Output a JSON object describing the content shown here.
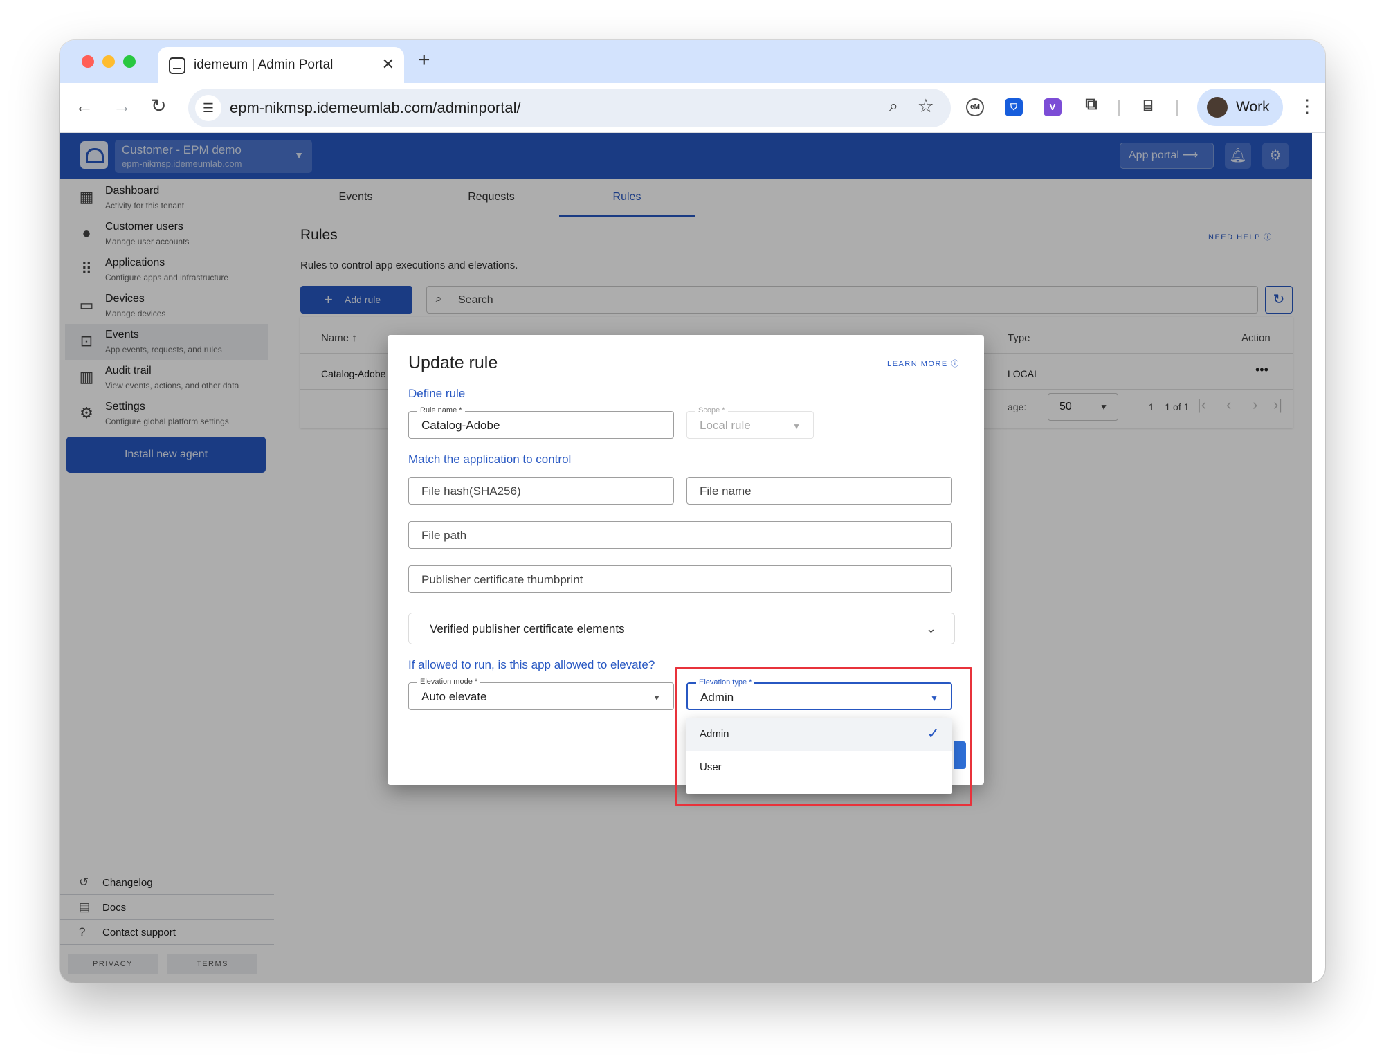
{
  "browser": {
    "tab_title": "idemeum | Admin Portal",
    "url": "epm-nikmsp.idemeumlab.com/adminportal/",
    "profile_label": "Work",
    "extensions": [
      "eM",
      "bitwarden",
      "V"
    ]
  },
  "header": {
    "tenant_name": "Customer - EPM demo",
    "tenant_url": "epm-nikmsp.idemeumlab.com",
    "app_portal_label": "App portal"
  },
  "sidebar": {
    "items": [
      {
        "title": "Dashboard",
        "subtitle": "Activity for this tenant",
        "icon": "dashboard-icon"
      },
      {
        "title": "Customer users",
        "subtitle": "Manage user accounts",
        "icon": "person-icon"
      },
      {
        "title": "Applications",
        "subtitle": "Configure apps and infrastructure",
        "icon": "apps-grid-icon"
      },
      {
        "title": "Devices",
        "subtitle": "Manage devices",
        "icon": "monitor-icon"
      },
      {
        "title": "Events",
        "subtitle": "App events, requests, and rules",
        "icon": "devices-icon"
      },
      {
        "title": "Audit trail",
        "subtitle": "View events, actions, and other data",
        "icon": "bar-chart-icon"
      },
      {
        "title": "Settings",
        "subtitle": "Configure global platform settings",
        "icon": "gear-icon"
      }
    ],
    "install_label": "Install new agent",
    "footer": [
      {
        "label": "Changelog",
        "icon": "history-icon"
      },
      {
        "label": "Docs",
        "icon": "document-icon"
      },
      {
        "label": "Contact support",
        "icon": "help-icon"
      }
    ],
    "privacy_label": "PRIVACY",
    "terms_label": "TERMS"
  },
  "main": {
    "tabs": [
      {
        "label": "Events"
      },
      {
        "label": "Requests"
      },
      {
        "label": "Rules"
      }
    ],
    "active_tab": "Rules",
    "title": "Rules",
    "need_help": "NEED HELP",
    "description": "Rules to control app executions and elevations.",
    "add_rule_label": "Add rule",
    "search_placeholder": "Search",
    "table": {
      "columns": {
        "name": "Name",
        "type": "Type",
        "action": "Action"
      },
      "rows": [
        {
          "name": "Catalog-Adobe",
          "type": "LOCAL",
          "action": "•••"
        }
      ],
      "per_page_label": "age:",
      "per_page_value": "50",
      "range": "1 – 1 of 1"
    }
  },
  "dialog": {
    "title": "Update rule",
    "learn_more": "LEARN MORE",
    "define_section": "Define rule",
    "rule_name_label": "Rule name *",
    "rule_name_value": "Catalog-Adobe",
    "scope_label": "Scope *",
    "scope_value": "Local rule",
    "match_section": "Match the application to control",
    "file_hash_placeholder": "File hash(SHA256)",
    "file_name_placeholder": "File name",
    "file_path_placeholder": "File path",
    "thumbprint_placeholder": "Publisher certificate thumbprint",
    "verified_elements_label": "Verified publisher certificate elements",
    "elevate_section": "If allowed to run, is this app allowed to elevate?",
    "elevation_mode_label": "Elevation mode *",
    "elevation_mode_value": "Auto elevate",
    "elevation_type_label": "Elevation type *",
    "elevation_type_value": "Admin"
  },
  "dropdown": {
    "options": [
      {
        "label": "Admin",
        "selected": true
      },
      {
        "label": "User",
        "selected": false
      }
    ]
  },
  "colors": {
    "brand": "#2757c2",
    "highlight": "#e8323b"
  }
}
